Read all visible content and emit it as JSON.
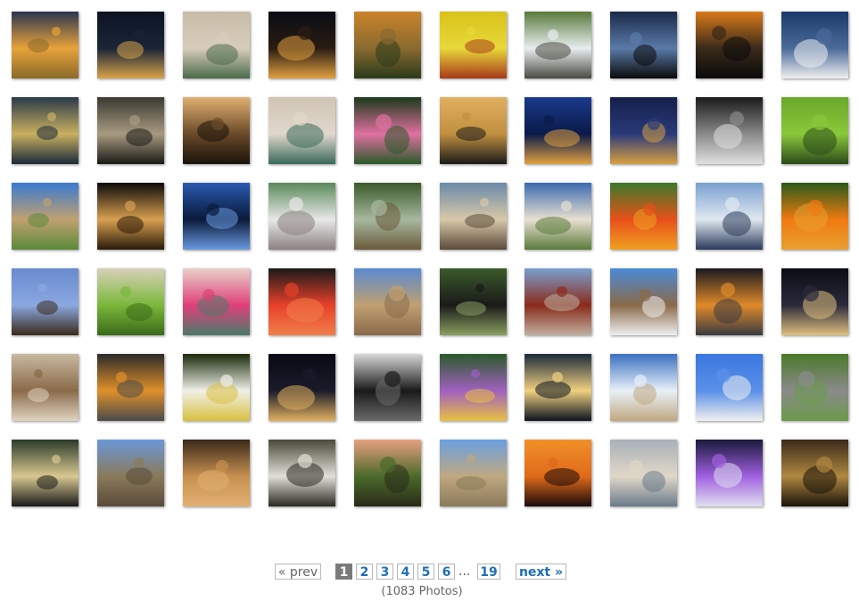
{
  "gallery": {
    "photos": [
      {
        "subject": "sunset-over-grass-field",
        "colors": [
          "#2a3550",
          "#e8a33a",
          "#8a6a2a"
        ]
      },
      {
        "subject": "city-skyline-night",
        "colors": [
          "#0c1424",
          "#1a2436",
          "#d9a44a"
        ]
      },
      {
        "subject": "hummingbird-in-flight",
        "colors": [
          "#c8bba8",
          "#d8cdbb",
          "#4a6a4a"
        ]
      },
      {
        "subject": "city-skyline-night",
        "colors": [
          "#0a0c14",
          "#2a1c12",
          "#e0a040"
        ]
      },
      {
        "subject": "mountain-valley-sunrise",
        "colors": [
          "#c9842a",
          "#8a6a30",
          "#2a3a1a"
        ]
      },
      {
        "subject": "yellow-lily-flower",
        "colors": [
          "#d9c21a",
          "#e8d83a",
          "#a83a1a"
        ]
      },
      {
        "subject": "waterfall-over-rocks",
        "colors": [
          "#5a7a3a",
          "#e8eef0",
          "#4a4a40"
        ]
      },
      {
        "subject": "sunset-tree-silhouettes",
        "colors": [
          "#1a2a4a",
          "#5a7aa8",
          "#0a0a0a"
        ]
      },
      {
        "subject": "bay-sunset-silhouette",
        "colors": [
          "#d97a1a",
          "#3a2a1a",
          "#0a0a0a"
        ]
      },
      {
        "subject": "seagull-over-water",
        "colors": [
          "#1a3a6a",
          "#4a6a9a",
          "#f0f0f0"
        ]
      },
      {
        "subject": "moonlit-bay-ship",
        "colors": [
          "#2a3a4a",
          "#c9b060",
          "#1a2a3a"
        ]
      },
      {
        "subject": "misty-sea-rocks",
        "colors": [
          "#3a3a32",
          "#a89a80",
          "#1a1a16"
        ]
      },
      {
        "subject": "driftwood-sunset",
        "colors": [
          "#e0b070",
          "#6a4a2a",
          "#1a120a"
        ]
      },
      {
        "subject": "hummingbird-in-flight",
        "colors": [
          "#d0c4b4",
          "#e0d8cc",
          "#3a6a5a"
        ]
      },
      {
        "subject": "pink-lotus-flower",
        "colors": [
          "#1a3a1a",
          "#e070a0",
          "#2a5a2a"
        ]
      },
      {
        "subject": "birds-flying-sunset",
        "colors": [
          "#e0b060",
          "#c09040",
          "#1a1a1a"
        ]
      },
      {
        "subject": "city-skyline-blue-hour",
        "colors": [
          "#1a3a8a",
          "#0a1a4a",
          "#e0a040"
        ]
      },
      {
        "subject": "city-skyline-blue-hour",
        "colors": [
          "#14204a",
          "#2a3a7a",
          "#d8a040"
        ]
      },
      {
        "subject": "coastal-lighthouse-bw",
        "colors": [
          "#1a1a1a",
          "#8a8a8a",
          "#e0e0e0"
        ]
      },
      {
        "subject": "green-praying-mantis",
        "colors": [
          "#6aa82a",
          "#8ac83a",
          "#2a4a1a"
        ]
      },
      {
        "subject": "coastal-path-blue-sky",
        "colors": [
          "#3a7ad0",
          "#c0a070",
          "#5a8a3a"
        ]
      },
      {
        "subject": "cheetah-face",
        "colors": [
          "#0a0a0a",
          "#d8a050",
          "#2a1a0a"
        ]
      },
      {
        "subject": "statue-silhouette",
        "colors": [
          "#2a5ab0",
          "#0a1a3a",
          "#6a9ae0"
        ]
      },
      {
        "subject": "white-dove",
        "colors": [
          "#5a8a5a",
          "#e8e8e8",
          "#8a8080"
        ]
      },
      {
        "subject": "forest-trail",
        "colors": [
          "#3a5a2a",
          "#a8b8a0",
          "#6a5a3a"
        ]
      },
      {
        "subject": "alcatraz-island",
        "colors": [
          "#6a8aa8",
          "#d8c8a8",
          "#5a4a3a"
        ]
      },
      {
        "subject": "coastal-beach-aerial",
        "colors": [
          "#3a6ab0",
          "#e8e0d0",
          "#5a7a3a"
        ]
      },
      {
        "subject": "orange-marigold",
        "colors": [
          "#3a7a2a",
          "#e8501a",
          "#f0a020"
        ]
      },
      {
        "subject": "bridge-city-skyline",
        "colors": [
          "#7aa0d0",
          "#e0e8f0",
          "#2a3a5a"
        ]
      },
      {
        "subject": "orange-marigold",
        "colors": [
          "#2a5a1a",
          "#f07a10",
          "#e8a030"
        ]
      },
      {
        "subject": "hawk-in-flight",
        "colors": [
          "#6a8ad0",
          "#8aa8e0",
          "#3a2a1a"
        ]
      },
      {
        "subject": "green-praying-mantis",
        "colors": [
          "#d8d0b8",
          "#7ab83a",
          "#3a6a1a"
        ]
      },
      {
        "subject": "hummingbird-pink-flower",
        "colors": [
          "#e8d0c8",
          "#e0407a",
          "#4a7a6a"
        ]
      },
      {
        "subject": "pink-flamingo",
        "colors": [
          "#1a1a1a",
          "#e8402a",
          "#f0804a"
        ]
      },
      {
        "subject": "historic-temple",
        "colors": [
          "#5a8ad0",
          "#c0a070",
          "#8a6a4a"
        ]
      },
      {
        "subject": "chimpanzee",
        "colors": [
          "#3a5a2a",
          "#1a1a1a",
          "#8aa060"
        ]
      },
      {
        "subject": "red-barn",
        "colors": [
          "#7aa0d0",
          "#8a2a1a",
          "#c0b0a0"
        ]
      },
      {
        "subject": "coastal-lighthouse",
        "colors": [
          "#4a8ad8",
          "#8a6a4a",
          "#f0f0f0"
        ]
      },
      {
        "subject": "ocean-sunset",
        "colors": [
          "#1a1a20",
          "#e08a2a",
          "#3a3a40"
        ]
      },
      {
        "subject": "city-lights-aerial",
        "colors": [
          "#0a0c14",
          "#2a2a3a",
          "#e0c080"
        ]
      },
      {
        "subject": "meerkat-standing",
        "colors": [
          "#c8b8a0",
          "#8a6a4a",
          "#e0d4c0"
        ]
      },
      {
        "subject": "street-sunset",
        "colors": [
          "#2a2a2a",
          "#e0902a",
          "#4a4a4a"
        ]
      },
      {
        "subject": "white-magnolia-flower",
        "colors": [
          "#1a2a0a",
          "#f0f0e8",
          "#d8c040"
        ]
      },
      {
        "subject": "city-lights-night",
        "colors": [
          "#0a0a14",
          "#1a1a2a",
          "#e0b060"
        ]
      },
      {
        "subject": "black-car",
        "colors": [
          "#d8d8d8",
          "#1a1a1a",
          "#6a6a6a"
        ]
      },
      {
        "subject": "purple-daisy-flowers",
        "colors": [
          "#2a5a2a",
          "#a060c0",
          "#e8c040"
        ]
      },
      {
        "subject": "lake-sunset",
        "colors": [
          "#1a2a3a",
          "#f0d080",
          "#0a1420"
        ]
      },
      {
        "subject": "beach-clouds-sky",
        "colors": [
          "#3a70c0",
          "#e8f0f8",
          "#c0a880"
        ]
      },
      {
        "subject": "seagull-blue-sky",
        "colors": [
          "#3a78e0",
          "#5a90e8",
          "#f0f0f0"
        ]
      },
      {
        "subject": "country-road-trees",
        "colors": [
          "#4a7a2a",
          "#8a8a8a",
          "#6a9a4a"
        ]
      },
      {
        "subject": "tram-interior",
        "colors": [
          "#2a3a2a",
          "#d8c890",
          "#1a1a1a"
        ]
      },
      {
        "subject": "ancient-temple-ruins",
        "colors": [
          "#6a98d8",
          "#8a7a5a",
          "#5a4a3a"
        ]
      },
      {
        "subject": "lion-cubs",
        "colors": [
          "#3a2a1a",
          "#c89050",
          "#e0b070"
        ]
      },
      {
        "subject": "forest-stream-rocks",
        "colors": [
          "#4a4a3a",
          "#e0e0d8",
          "#2a2a20"
        ]
      },
      {
        "subject": "dragonfly-closeup",
        "colors": [
          "#e8a080",
          "#4a6a2a",
          "#2a2a1a"
        ]
      },
      {
        "subject": "temple-pavilion",
        "colors": [
          "#6aa0e0",
          "#c0a880",
          "#8a7a5a"
        ]
      },
      {
        "subject": "balloon-sunset",
        "colors": [
          "#f0902a",
          "#e06a1a",
          "#1a0a0a"
        ]
      },
      {
        "subject": "seagull-on-beach",
        "colors": [
          "#a8b0b8",
          "#e0d8c8",
          "#6a7a8a"
        ]
      },
      {
        "subject": "waterfall-night-lights",
        "colors": [
          "#1a1a3a",
          "#a060e0",
          "#e0e0f0"
        ]
      },
      {
        "subject": "bronze-statue",
        "colors": [
          "#3a2a1a",
          "#b08840",
          "#1a120a"
        ]
      }
    ]
  },
  "pagination": {
    "prev_label": "« prev",
    "pages": [
      "1",
      "2",
      "3",
      "4",
      "5",
      "6"
    ],
    "ellipsis": "...",
    "last_page": "19",
    "next_label": "next »",
    "current_page": "1",
    "count_text": "(1083 Photos)"
  },
  "colors": {
    "link": "#1f6fb5",
    "current_bg": "#7a7a7a",
    "border": "#b7b7b7",
    "muted": "#666666"
  }
}
